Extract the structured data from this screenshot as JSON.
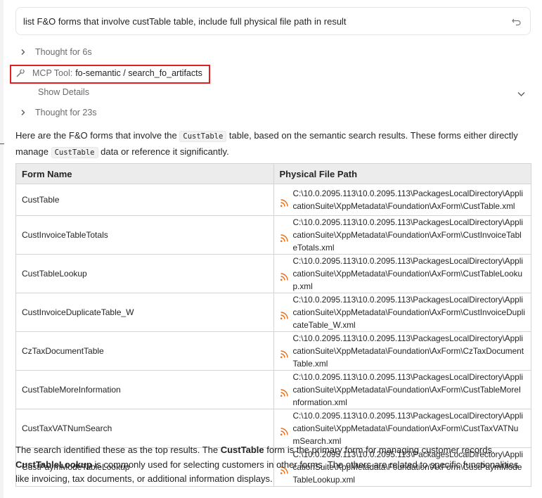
{
  "prompt": {
    "text": "list F&O forms that involve custTable table, include full physical file path in result",
    "undo_icon": "undo-icon"
  },
  "thoughts": [
    {
      "label": "Thought for 6s"
    },
    {
      "label": "Thought for 23s"
    }
  ],
  "tool": {
    "label": "MCP Tool:",
    "name": "fo-semantic / search_fo_artifacts",
    "show_details": "Show Details",
    "highlight_color": "#e02020"
  },
  "intro": {
    "part1": "Here are the F&O forms that involve the ",
    "code1": "CustTable",
    "part2": " table, based on the semantic search results. These forms either directly manage ",
    "code2": "CustTable",
    "part3": " data or reference it significantly."
  },
  "table": {
    "headers": [
      "Form Name",
      "Physical File Path"
    ],
    "rows": [
      {
        "name": "CustTable",
        "path": "C:\\10.0.2095.113\\10.0.2095.113\\PackagesLocalDirectory\\ApplicationSuite\\XppMetadata\\Foundation\\AxForm\\CustTable.xml"
      },
      {
        "name": "CustInvoiceTableTotals",
        "path": "C:\\10.0.2095.113\\10.0.2095.113\\PackagesLocalDirectory\\ApplicationSuite\\XppMetadata\\Foundation\\AxForm\\CustInvoiceTableTotals.xml"
      },
      {
        "name": "CustTableLookup",
        "path": "C:\\10.0.2095.113\\10.0.2095.113\\PackagesLocalDirectory\\ApplicationSuite\\XppMetadata\\Foundation\\AxForm\\CustTableLookup.xml"
      },
      {
        "name": "CustInvoiceDuplicateTable_W",
        "path": "C:\\10.0.2095.113\\10.0.2095.113\\PackagesLocalDirectory\\ApplicationSuite\\XppMetadata\\Foundation\\AxForm\\CustInvoiceDuplicateTable_W.xml"
      },
      {
        "name": "CzTaxDocumentTable",
        "path": "C:\\10.0.2095.113\\10.0.2095.113\\PackagesLocalDirectory\\ApplicationSuite\\XppMetadata\\Foundation\\AxForm\\CzTaxDocumentTable.xml"
      },
      {
        "name": "CustTableMoreInformation",
        "path": "C:\\10.0.2095.113\\10.0.2095.113\\PackagesLocalDirectory\\ApplicationSuite\\XppMetadata\\Foundation\\AxForm\\CustTableMoreInformation.xml"
      },
      {
        "name": "CustTaxVATNumSearch",
        "path": "C:\\10.0.2095.113\\10.0.2095.113\\PackagesLocalDirectory\\ApplicationSuite\\XppMetadata\\Foundation\\AxForm\\CustTaxVATNumSearch.xml"
      },
      {
        "name": "CustPaymModeTableLookup",
        "path": "C:\\10.0.2095.113\\10.0.2095.113\\PackagesLocalDirectory\\ApplicationSuite\\XppMetadata\\Foundation\\AxForm\\CustPaymModeTableLookup.xml"
      }
    ],
    "row_icon": "rss-icon",
    "icon_color": "#e8701a"
  },
  "summary": {
    "s1": "The search identified these as the top results. The ",
    "b1": "CustTable",
    "s2": " form is the primary form for managing customer records. ",
    "b2": "CustTableLookup",
    "s3": " is commonly used for selecting customers in other forms. The others are related to specific functionalities like invoicing, tax documents, or additional information displays."
  }
}
